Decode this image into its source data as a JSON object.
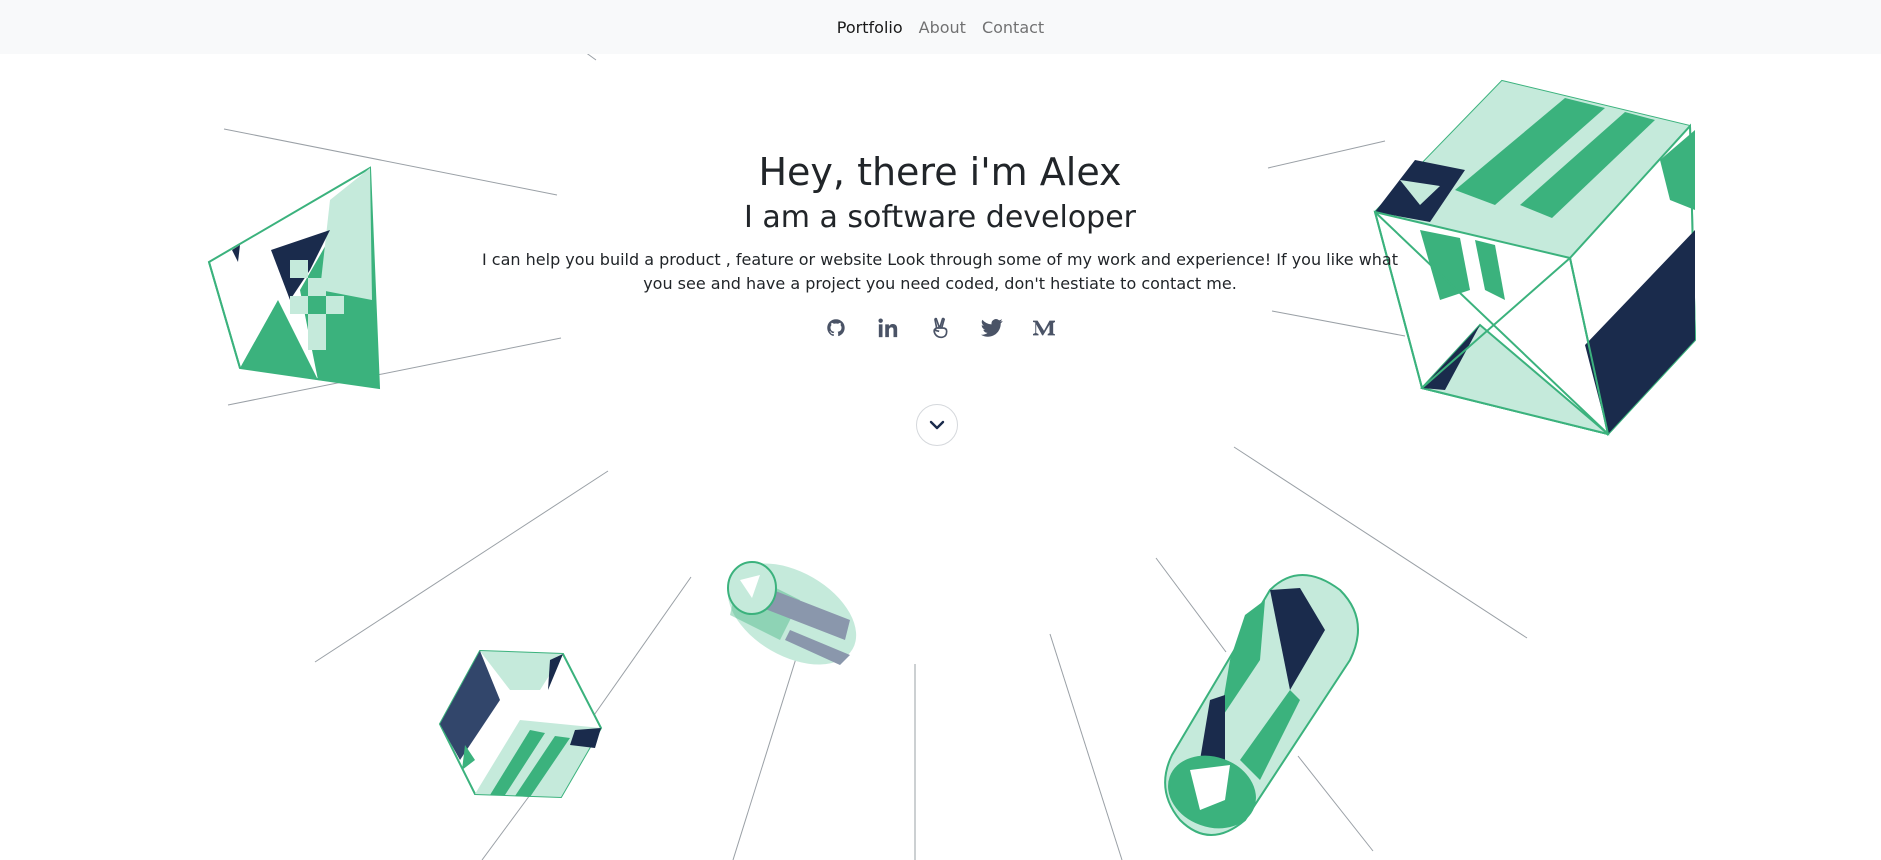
{
  "nav": {
    "items": [
      {
        "label": "Portfolio"
      },
      {
        "label": "About"
      },
      {
        "label": "Contact"
      }
    ]
  },
  "hero": {
    "title": "Hey, there i'm Alex",
    "subtitle": "I am a software developer",
    "description": "I can help you build a product , feature or website Look through some of my work and experience! If you like what you see and have a project you need coded, don't hestiate to contact me."
  },
  "socials": [
    {
      "icon": "github-icon"
    },
    {
      "icon": "linkedin-icon"
    },
    {
      "icon": "angellist-icon"
    },
    {
      "icon": "twitter-icon"
    },
    {
      "icon": "medium-icon"
    }
  ],
  "scroll": {
    "icon": "chevron-down-icon"
  },
  "colors": {
    "green": "#3bb27d",
    "mint": "#c5eadb",
    "navy": "#1a2b4c",
    "text": "#212529",
    "icon": "#4a5366",
    "navbar_bg": "#f8f9fa"
  }
}
